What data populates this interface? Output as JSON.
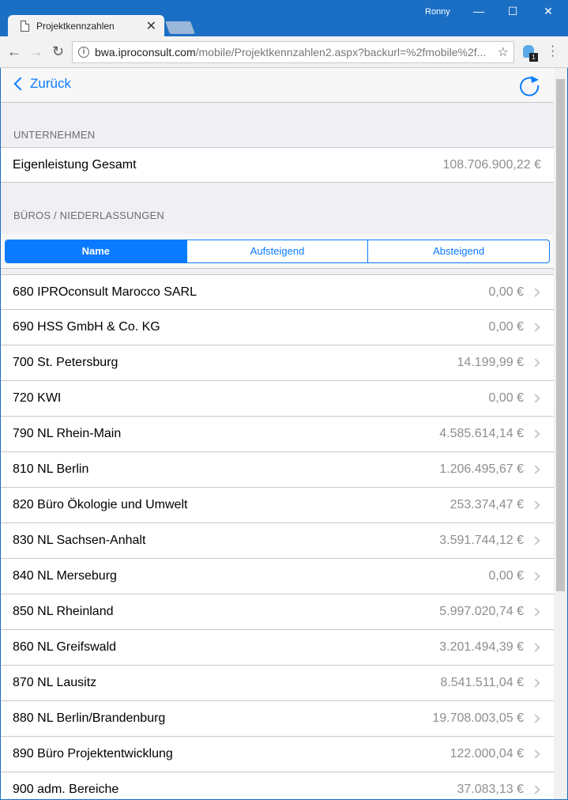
{
  "window": {
    "tab_title": "Projektkennzahlen",
    "user": "Ronny",
    "minimize": "—",
    "maximize": "☐",
    "close": "✕"
  },
  "browser": {
    "url_domain": "bwa.iproconsult.com",
    "url_path": "/mobile/Projektkennzahlen2.aspx?backurl=%2fmobile%2f...",
    "extension_badge": "1"
  },
  "app": {
    "back_label": "Zurück"
  },
  "company": {
    "header": "UNTERNEHMEN",
    "row_label": "Eigenleistung Gesamt",
    "row_value": "108.706.900,22 €"
  },
  "offices": {
    "header": "BÜROS / NIEDERLASSUNGEN",
    "sort": {
      "options": [
        "Name",
        "Aufsteigend",
        "Absteigend"
      ],
      "active": "Name"
    },
    "items": [
      {
        "label": "680 IPROconsult Marocco SARL",
        "value": "0,00 €"
      },
      {
        "label": "690 HSS GmbH & Co. KG",
        "value": "0,00 €"
      },
      {
        "label": "700 St. Petersburg",
        "value": "14.199,99 €"
      },
      {
        "label": "720 KWI",
        "value": "0,00 €"
      },
      {
        "label": "790 NL Rhein-Main",
        "value": "4.585.614,14 €"
      },
      {
        "label": "810 NL Berlin",
        "value": "1.206.495,67 €"
      },
      {
        "label": "820 Büro Ökologie und Umwelt",
        "value": "253.374,47 €"
      },
      {
        "label": "830 NL Sachsen-Anhalt",
        "value": "3.591.744,12 €"
      },
      {
        "label": "840 NL Merseburg",
        "value": "0,00 €"
      },
      {
        "label": "850 NL Rheinland",
        "value": "5.997.020,74 €"
      },
      {
        "label": "860 NL Greifswald",
        "value": "3.201.494,39 €"
      },
      {
        "label": "870 NL Lausitz",
        "value": "8.541.511,04 €"
      },
      {
        "label": "880 NL Berlin/Brandenburg",
        "value": "19.708.003,05 €"
      },
      {
        "label": "890 Büro Projektentwicklung",
        "value": "122.000,04 €"
      },
      {
        "label": "900 adm. Bereiche",
        "value": "37.083,13 €"
      }
    ]
  }
}
